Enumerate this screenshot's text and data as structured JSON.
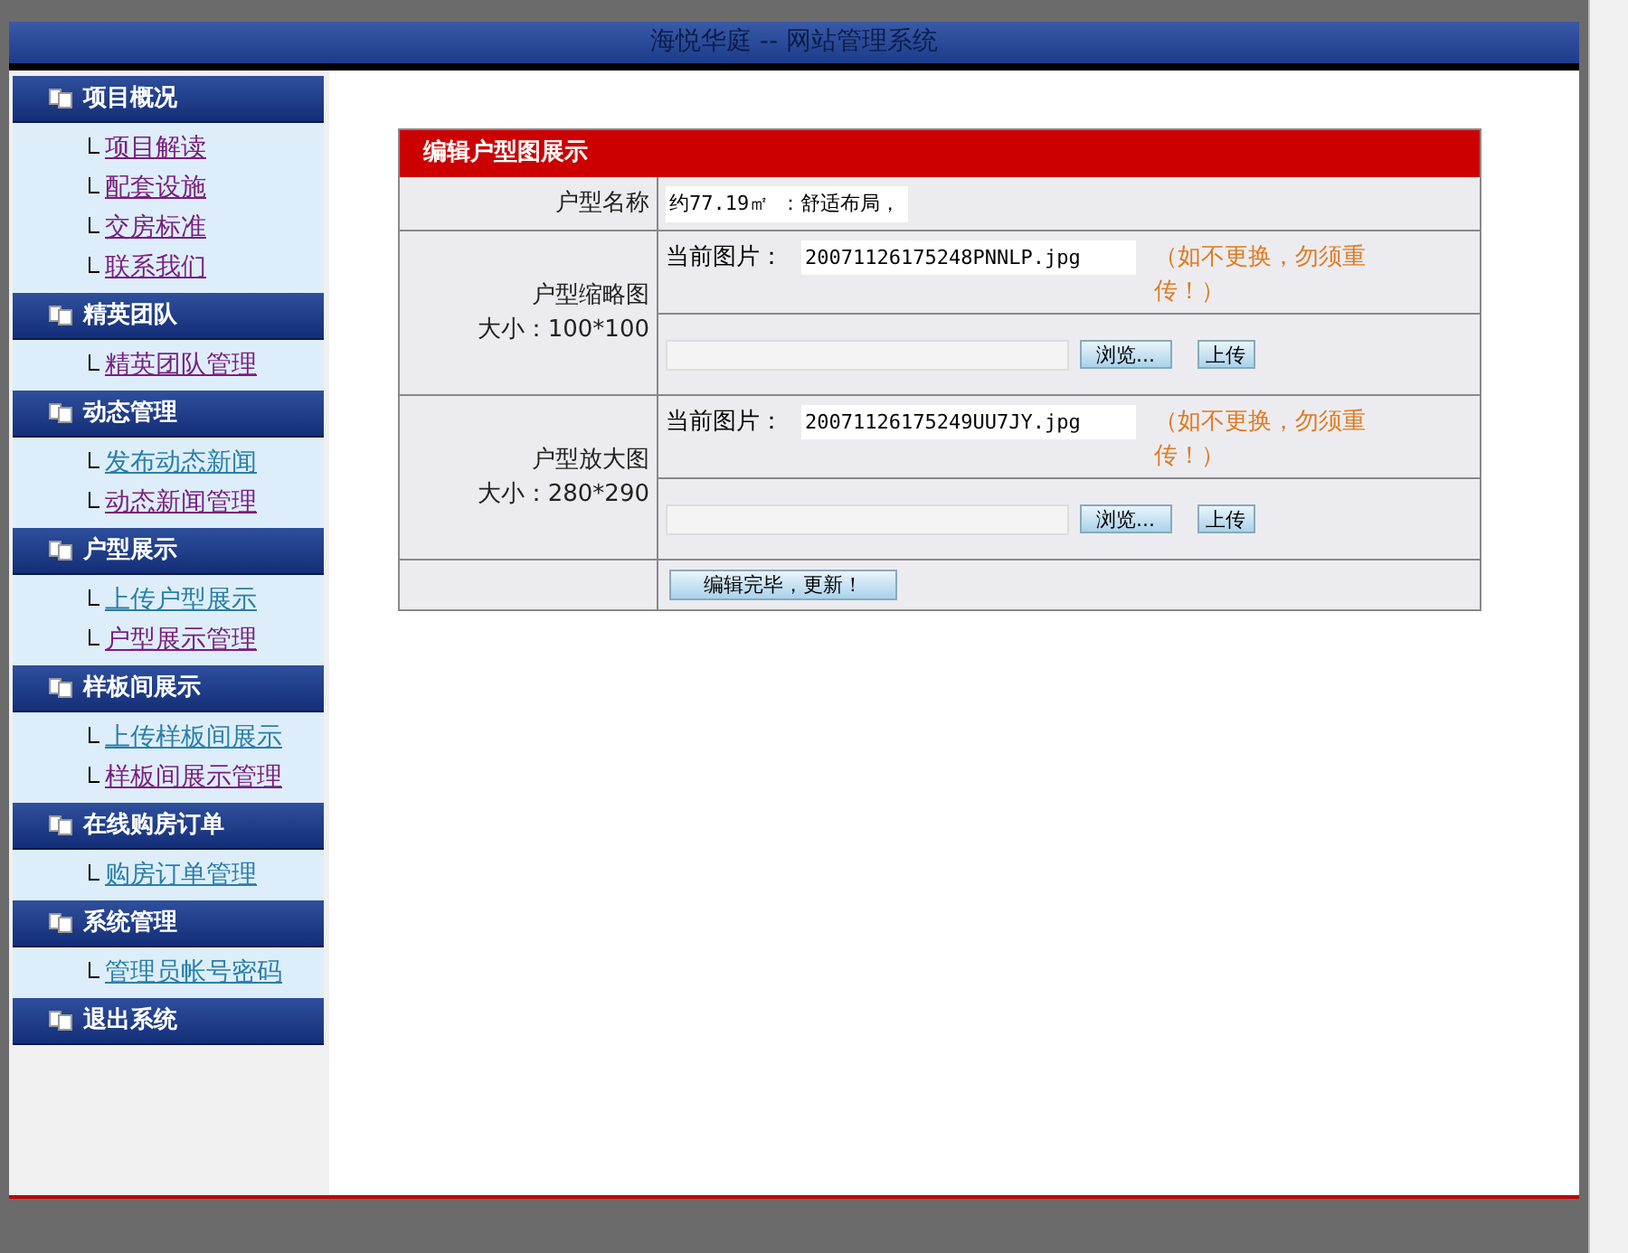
{
  "window": {
    "title": "海悦华庭 -- 网站管理系统"
  },
  "sidebar": {
    "sections": [
      {
        "title": "项目概况",
        "items": [
          {
            "label": "项目解读",
            "visited": true
          },
          {
            "label": "配套设施",
            "visited": true
          },
          {
            "label": "交房标准",
            "visited": true
          },
          {
            "label": "联系我们",
            "visited": true
          }
        ]
      },
      {
        "title": "精英团队",
        "items": [
          {
            "label": "精英团队管理",
            "visited": true
          }
        ]
      },
      {
        "title": "动态管理",
        "items": [
          {
            "label": "发布动态新闻",
            "visited": false
          },
          {
            "label": "动态新闻管理",
            "visited": true
          }
        ]
      },
      {
        "title": "户型展示",
        "items": [
          {
            "label": "上传户型展示",
            "visited": false
          },
          {
            "label": "户型展示管理",
            "visited": true
          }
        ]
      },
      {
        "title": "样板间展示",
        "items": [
          {
            "label": "上传样板间展示",
            "visited": false
          },
          {
            "label": "样板间展示管理",
            "visited": true
          }
        ]
      },
      {
        "title": "在线购房订单",
        "items": [
          {
            "label": "购房订单管理",
            "visited": false
          }
        ]
      },
      {
        "title": "系统管理",
        "items": [
          {
            "label": "管理员帐号密码",
            "visited": false
          }
        ]
      },
      {
        "title": "退出系统"
      }
    ]
  },
  "form": {
    "title": "编辑户型图展示",
    "name_row": {
      "label": "户型名称",
      "value": "约77.19㎡ ：舒适布局，"
    },
    "image_rows": [
      {
        "label": "户型缩略图",
        "size": "大小：100*100",
        "current_label": "当前图片：",
        "current_value": "20071126175248PNNLP.jpg",
        "hint": "（如不更换，勿须重传！）",
        "browse": "浏览...",
        "upload": "上传"
      },
      {
        "label": "户型放大图",
        "size": "大小：280*290",
        "current_label": "当前图片：",
        "current_value": "20071126175249UU7JY.jpg",
        "hint": "（如不更换，勿须重传！）",
        "browse": "浏览...",
        "upload": "上传"
      }
    ],
    "submit": "编辑完毕，更新！"
  }
}
